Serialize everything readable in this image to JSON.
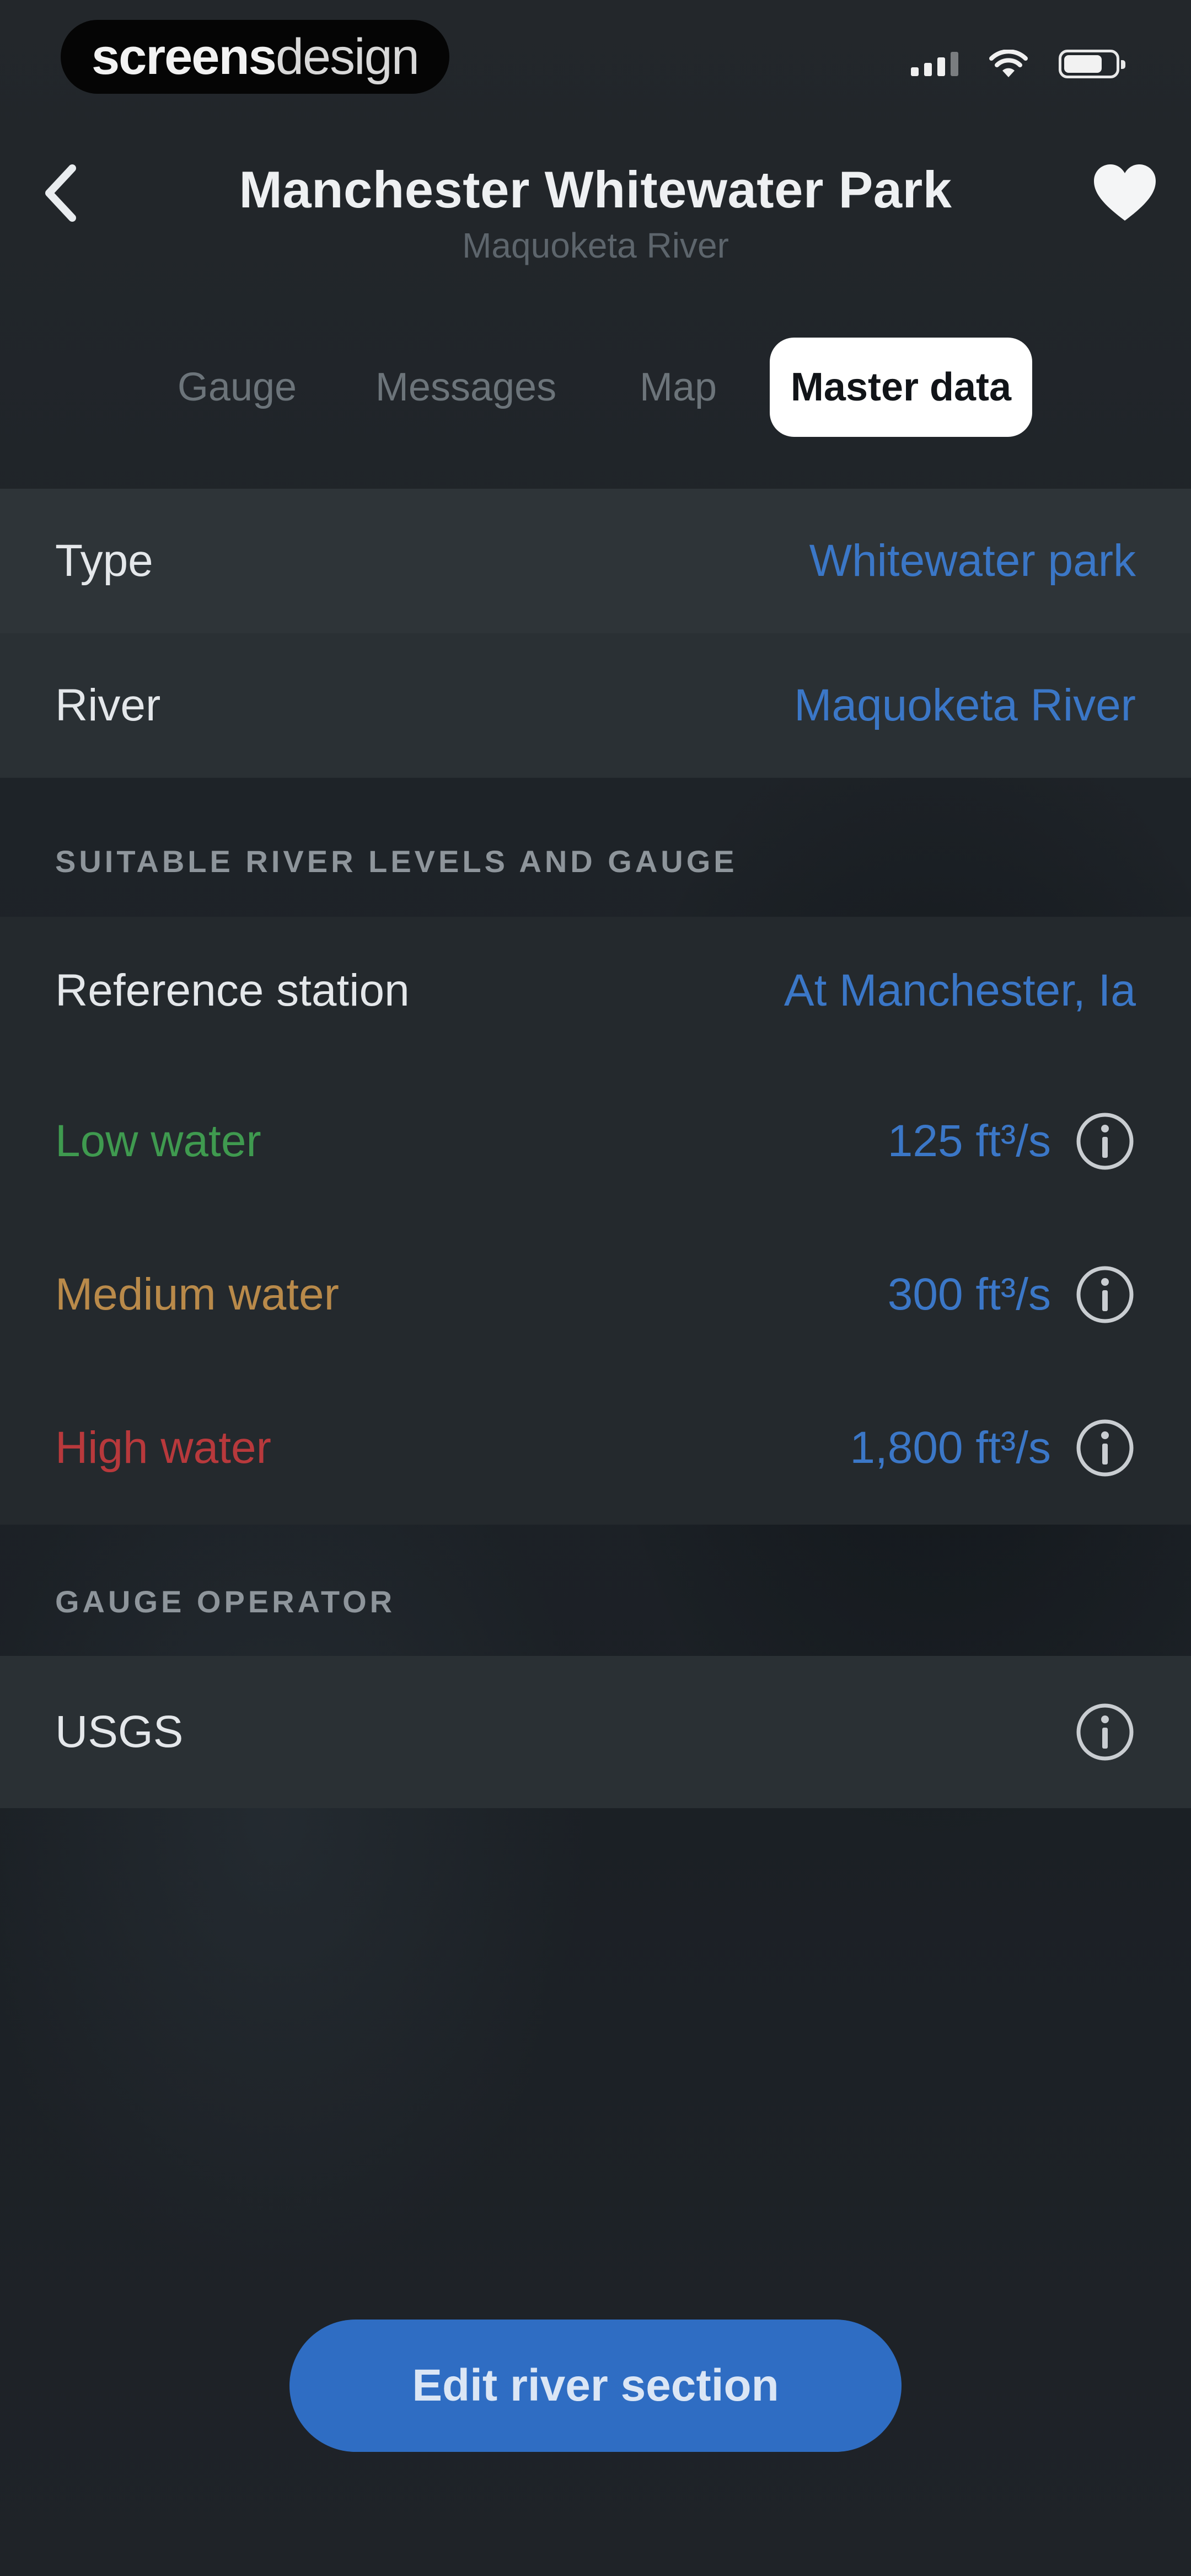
{
  "status_bar": {
    "watermark_bold": "screens",
    "watermark_light": "design"
  },
  "header": {
    "title": "Manchester Whitewater Park",
    "subtitle": "Maquoketa River"
  },
  "tabs": [
    {
      "label": "Gauge",
      "active": false
    },
    {
      "label": "Messages",
      "active": false
    },
    {
      "label": "Map",
      "active": false
    },
    {
      "label": "Master data",
      "active": true
    }
  ],
  "master_data": {
    "type": {
      "label": "Type",
      "value": "Whitewater park"
    },
    "river": {
      "label": "River",
      "value": "Maquoketa River"
    }
  },
  "levels": {
    "section_title": "SUITABLE RIVER LEVELS AND GAUGE",
    "reference": {
      "label": "Reference station",
      "value": "At Manchester, Ia"
    },
    "low": {
      "label": "Low water",
      "value": "125 ft³/s",
      "color": "#3f9a4f"
    },
    "medium": {
      "label": "Medium water",
      "value": "300 ft³/s",
      "color": "#b98a4a"
    },
    "high": {
      "label": "High water",
      "value": "1,800 ft³/s",
      "color": "#b8393c"
    }
  },
  "operator": {
    "section_title": "GAUGE OPERATOR",
    "name": "USGS"
  },
  "action": {
    "edit_label": "Edit river section"
  },
  "colors": {
    "accent": "#3b77c7",
    "button": "#2f6dc3"
  },
  "icons": {
    "back": "chevron-left-icon",
    "favorite": "heart-icon",
    "info": "info-icon"
  }
}
